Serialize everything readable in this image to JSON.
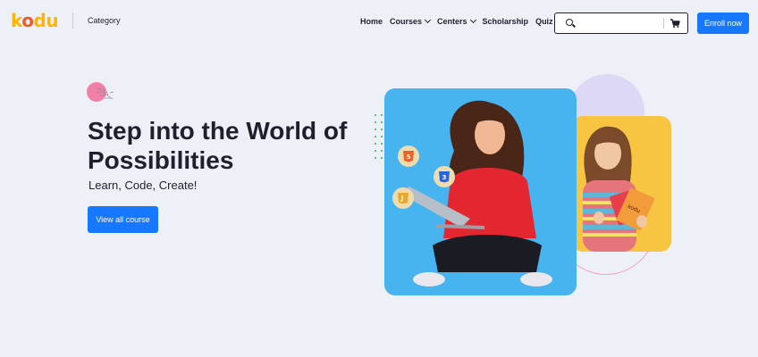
{
  "brand": {
    "logo_k": "k",
    "logo_o": "o",
    "logo_du": "du"
  },
  "nav": {
    "category": "Category",
    "items": [
      {
        "label": "Home",
        "has_dropdown": false
      },
      {
        "label": "Courses",
        "has_dropdown": true
      },
      {
        "label": "Centers",
        "has_dropdown": true
      },
      {
        "label": "Scholarship",
        "has_dropdown": false
      },
      {
        "label": "Quiz",
        "has_dropdown": true
      }
    ],
    "search_placeholder": "",
    "enroll_label": "Enroll now"
  },
  "hero": {
    "title": "Step into the World of Possibilities",
    "subtitle": "Learn, Code, Create!",
    "cta_label": "View all course",
    "badges": [
      {
        "icon": "html5-icon",
        "number": "5"
      },
      {
        "icon": "css3-icon",
        "number": "3"
      },
      {
        "icon": "javascript-icon",
        "number": ""
      }
    ]
  },
  "colors": {
    "background": "#eef0f7",
    "primary": "#1677ff",
    "logo_yellow": "#ffb400",
    "logo_orange": "#f05a28",
    "photo_blue": "#48b4ef",
    "photo_yellow": "#f8c543",
    "lavender": "#dcd8f6",
    "pink": "#f27fa8"
  }
}
